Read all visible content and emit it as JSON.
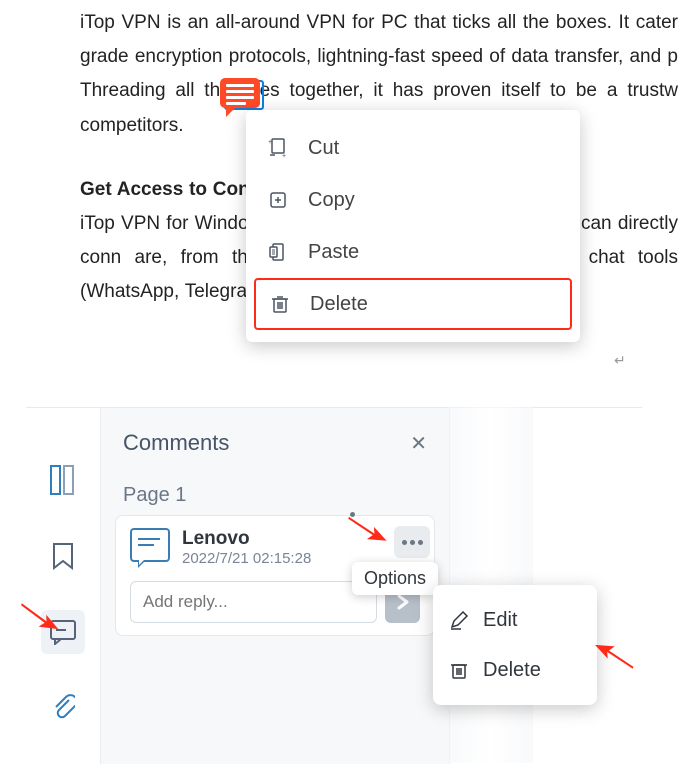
{
  "doc": {
    "p1": "iTop VPN is an all-around VPN for PC that ticks all the boxes. It cater grade encryption protocols, lightning-fast speed of data transfer, and p Threading all the lines together, it has proven itself to be a trustw competitors.",
    "heading": "Get Access to Conten",
    "p2": "iTop VPN for Window                                                                     Vith access to the services                                                                       's m you can directly conn                                                                       are, from the streaming v                                                               he (PUBG, Roblox), chat tools (WhatsApp, Telegram, Skype), or social me"
  },
  "ctx": {
    "cut": "Cut",
    "copy": "Copy",
    "paste": "Paste",
    "delete": "Delete"
  },
  "panel": {
    "title": "Comments",
    "page": "Page 1",
    "author": "Lenovo",
    "timestamp": "2022/7/21 02:15:28",
    "reply_placeholder": "Add reply...",
    "options_tooltip": "Options"
  },
  "ctx2": {
    "edit": "Edit",
    "delete": "Delete"
  },
  "colors": {
    "highlight_border": "#ff2a18",
    "arrow": "#ff2a18",
    "accent": "#0d7fe0"
  }
}
